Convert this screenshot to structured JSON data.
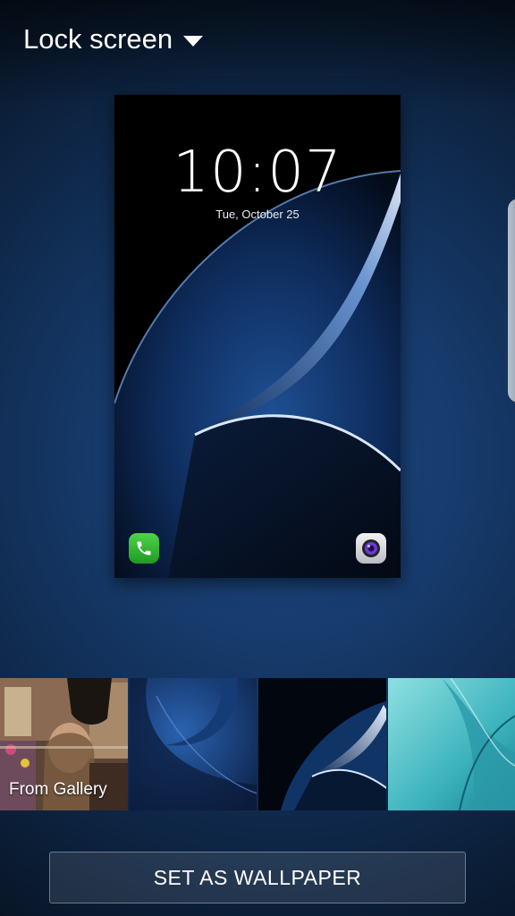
{
  "header": {
    "title": "Lock screen",
    "dropdown_icon": "caret-down-icon"
  },
  "preview": {
    "time": "10:07",
    "date": "Tue, October 25",
    "left_shortcut_icon": "phone-icon",
    "right_shortcut_icon": "camera-icon"
  },
  "thumbnails": [
    {
      "label": "From Gallery"
    },
    {
      "label": ""
    },
    {
      "label": ""
    },
    {
      "label": ""
    }
  ],
  "actions": {
    "set_wallpaper_label": "SET AS WALLPAPER"
  },
  "colors": {
    "phone_icon": "#2db52f",
    "camera_lens": "#6a3bd6",
    "background_blue": "#1d4a85"
  }
}
